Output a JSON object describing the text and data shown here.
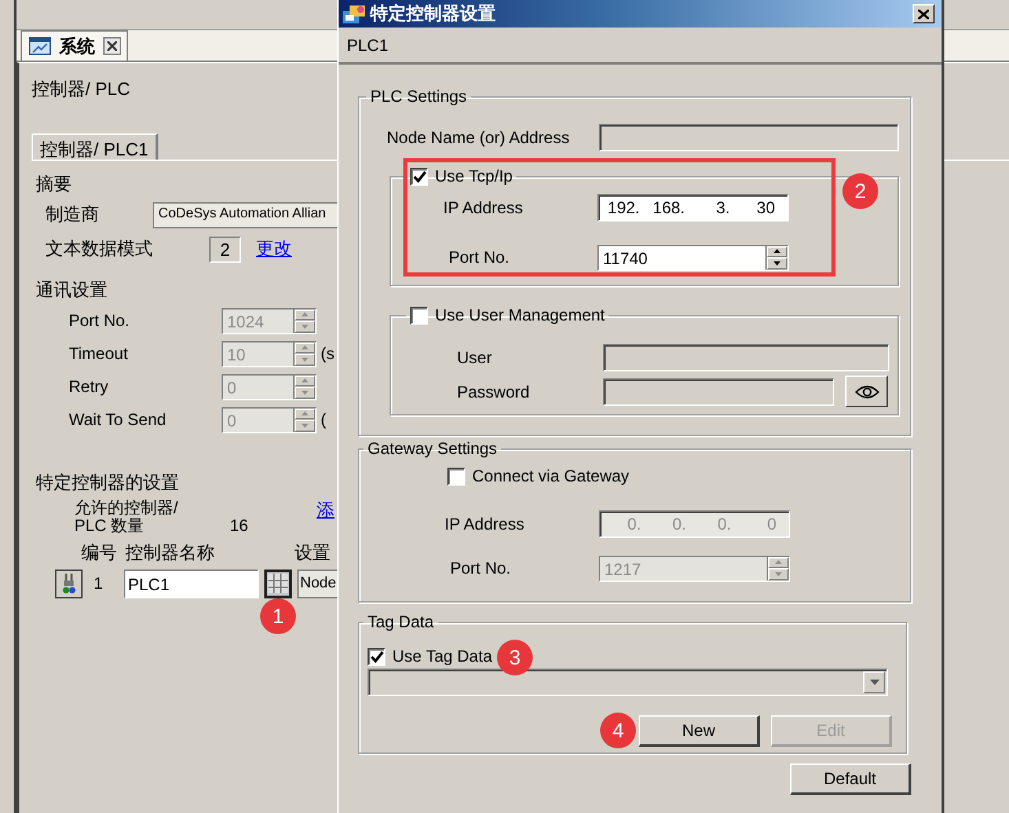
{
  "workspace": {
    "top_tab": {
      "label": "系统",
      "selected": true
    },
    "heading": "控制器/ PLC",
    "inner_tab": {
      "label": "控制器/ PLC1",
      "selected": true
    },
    "summary": {
      "title": "摘要",
      "maker_label": "制造商",
      "maker_value": "CoDeSys Automation Allian",
      "text_mode_label": "文本数据模式",
      "text_mode_value": "2",
      "change_link": "更改"
    },
    "comm": {
      "title": "通讯设置",
      "rows": [
        {
          "label": "Port No.",
          "value": "1024",
          "disabled": true
        },
        {
          "label": "Timeout",
          "value": "10",
          "unit": "(s",
          "disabled": true
        },
        {
          "label": "Retry",
          "value": "0",
          "disabled": true
        },
        {
          "label": "Wait To Send",
          "value": "0",
          "unit": "(",
          "disabled": true
        }
      ]
    },
    "specific": {
      "title": "特定控制器的设置",
      "allowed_lines": [
        "允许的控制器/",
        "PLC 数量"
      ],
      "allowed_value": "16",
      "add_link": "添",
      "columns": [
        "编号",
        "控制器名称",
        "设置"
      ],
      "rows": [
        {
          "number": "1",
          "name": "PLC1",
          "setting": "Node"
        }
      ]
    }
  },
  "dialog": {
    "title": "特定控制器设置",
    "subtitle": "PLC1",
    "plc_settings": {
      "title": "PLC Settings",
      "node_label": "Node Name (or) Address",
      "tcp": {
        "label": "Use Tcp/Ip",
        "checked": true,
        "ip_label": "IP Address",
        "ip": [
          "192.",
          "168.",
          "3.",
          "30"
        ],
        "port_label": "Port No.",
        "port": "11740"
      },
      "user_mgmt": {
        "label": "Use User Management",
        "checked": false,
        "disabled": true,
        "user_label": "User",
        "password_label": "Password"
      }
    },
    "gateway": {
      "title": "Gateway Settings",
      "label": "Connect via Gateway",
      "checked": false,
      "disabled": true,
      "ip_label": "IP Address",
      "ip": [
        "0.",
        "0.",
        "0.",
        "0"
      ],
      "port_label": "Port No.",
      "port": "1217"
    },
    "tag_data": {
      "title": "Tag Data",
      "label": "Use Tag Data",
      "checked": true,
      "buttons": [
        {
          "label": "New",
          "disabled": false
        },
        {
          "label": "Edit",
          "disabled": true
        }
      ]
    },
    "default_button": "Default"
  },
  "annotations": [
    {
      "number": "1"
    },
    {
      "number": "2"
    },
    {
      "number": "3"
    },
    {
      "number": "4"
    }
  ]
}
